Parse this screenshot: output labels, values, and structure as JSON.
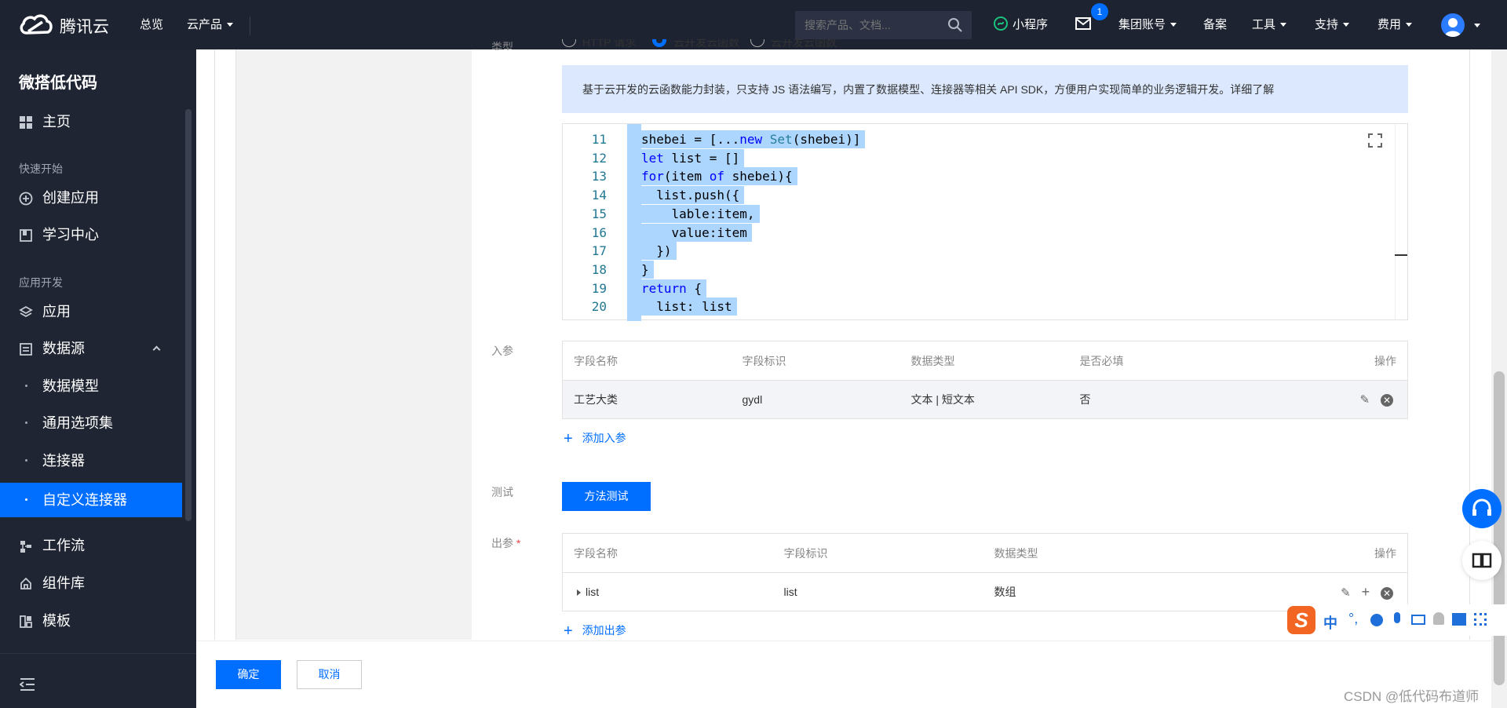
{
  "topbar": {
    "logo": "腾讯云",
    "nav": [
      "总览",
      "云产品"
    ],
    "search_placeholder": "搜索产品、文档...",
    "mini_program": "小程序",
    "mail_badge": "1",
    "right_items": [
      "集团账号",
      "备案",
      "工具",
      "支持",
      "费用"
    ]
  },
  "sidebar": {
    "title": "微搭低代码",
    "home": "主页",
    "section_quick": "快速开始",
    "create_app": "创建应用",
    "learn_center": "学习中心",
    "section_dev": "应用开发",
    "app": "应用",
    "datasource": "数据源",
    "sub_items": [
      "数据模型",
      "通用选项集",
      "连接器",
      "自定义连接器"
    ],
    "workflow": "工作流",
    "components": "组件库",
    "templates": "模板"
  },
  "form": {
    "type_label": "类型",
    "type_options": [
      "HTTP 请求",
      "云开发云函数",
      "云开发云函数"
    ],
    "info_text": "基于云开发的云函数能力封装，只支持 JS 语法编写，内置了数据模型、连接器等相关 API SDK，方便用户实现简单的业务逻辑开发。详细了解",
    "code_lines": [
      {
        "n": "11",
        "text": "shebei = [...new Set(shebei)]"
      },
      {
        "n": "12",
        "text": "let list = []"
      },
      {
        "n": "13",
        "text": "for(item of shebei){"
      },
      {
        "n": "14",
        "text": "  list.push({"
      },
      {
        "n": "15",
        "text": "    lable:item,"
      },
      {
        "n": "16",
        "text": "    value:item"
      },
      {
        "n": "17",
        "text": "  })"
      },
      {
        "n": "18",
        "text": "}"
      },
      {
        "n": "19",
        "text": "return {"
      },
      {
        "n": "20",
        "text": "  list: list"
      }
    ],
    "input_label": "入参",
    "input_headers": [
      "字段名称",
      "字段标识",
      "数据类型",
      "是否必填",
      "操作"
    ],
    "input_rows": [
      [
        "工艺大类",
        "gydl",
        "文本 | 短文本",
        "否"
      ]
    ],
    "add_input": "添加入参",
    "test_label": "测试",
    "test_button": "方法测试",
    "output_label": "出参",
    "output_headers": [
      "字段名称",
      "字段标识",
      "数据类型",
      "操作"
    ],
    "output_rows": [
      [
        "list",
        "list",
        "数组"
      ]
    ],
    "add_output": "添加出参"
  },
  "footer": {
    "confirm": "确定",
    "cancel": "取消"
  },
  "watermark": "CSDN @低代码布道师",
  "ime": {
    "zh": "中"
  }
}
